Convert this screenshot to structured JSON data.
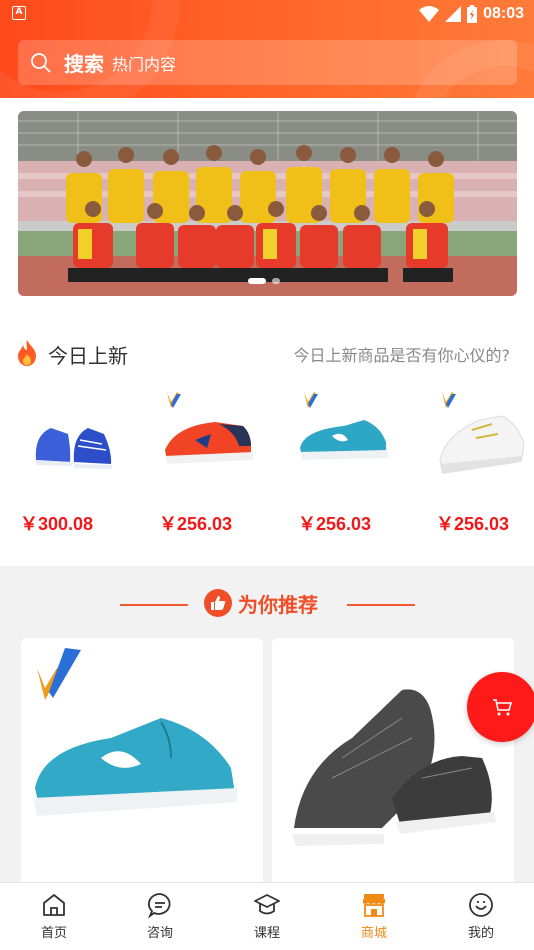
{
  "status_bar": {
    "time": "08:03"
  },
  "search": {
    "main_label": "搜索",
    "placeholder": "热门内容"
  },
  "new_today": {
    "title": "今日上新",
    "subtitle": "今日上新商品是否有你心仪的?",
    "products": [
      {
        "price": "￥300.08"
      },
      {
        "price": "￥256.03"
      },
      {
        "price": "￥256.03"
      },
      {
        "price": "￥256.03"
      }
    ]
  },
  "recommend": {
    "title": "为你推荐"
  },
  "tabbar": {
    "items": [
      {
        "label": "首页",
        "icon": "home-icon"
      },
      {
        "label": "咨询",
        "icon": "chat-icon"
      },
      {
        "label": "课程",
        "icon": "graduation-cap-icon"
      },
      {
        "label": "商城",
        "icon": "store-icon",
        "active": true
      },
      {
        "label": "我的",
        "icon": "profile-icon"
      }
    ]
  },
  "colors": {
    "brand": "#ff5a22",
    "price": "#f01818",
    "active_tab": "#f08a17",
    "cart": "#ff1a1a"
  }
}
